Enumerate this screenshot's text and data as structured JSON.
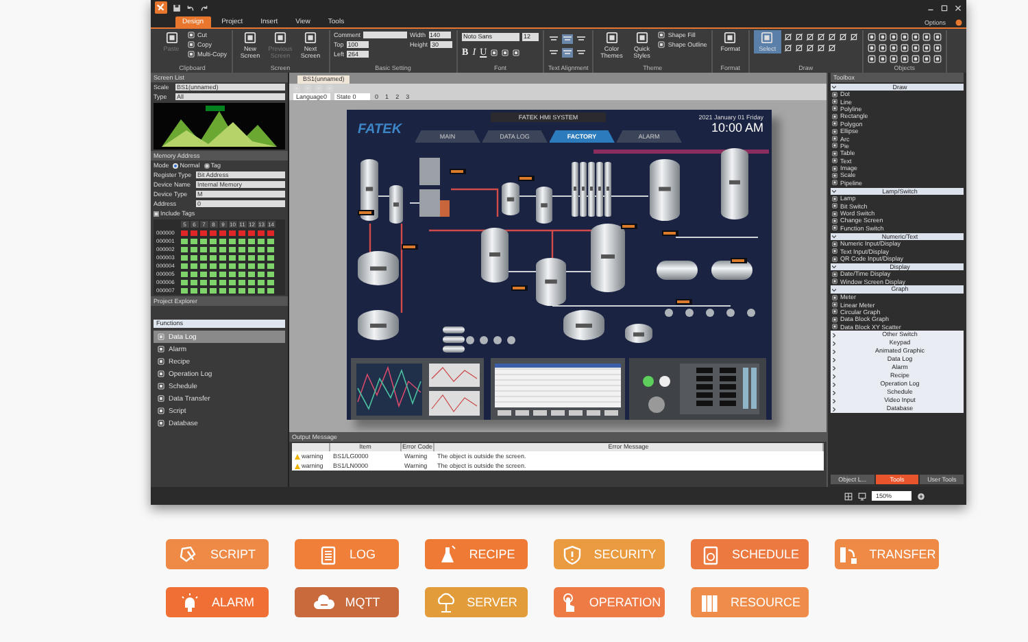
{
  "window": {
    "menu_tabs": [
      {
        "label": "Design",
        "selected": true
      },
      {
        "label": "Project",
        "selected": false
      },
      {
        "label": "Insert",
        "selected": false
      },
      {
        "label": "View",
        "selected": false
      },
      {
        "label": "Tools",
        "selected": false
      }
    ],
    "options_label": "Options",
    "ribbon": [
      {
        "name": "Clipboard",
        "kind": "buttons",
        "items": [
          {
            "kind": "large",
            "label": "Paste",
            "disabled": true
          },
          {
            "kind": "small",
            "label": "Cut"
          },
          {
            "kind": "small",
            "label": "Copy"
          },
          {
            "kind": "small",
            "label": "Multi-Copy"
          }
        ]
      },
      {
        "name": "Screen",
        "kind": "buttons",
        "items": [
          {
            "kind": "large",
            "label": "New Screen",
            "disabled": false
          },
          {
            "kind": "large",
            "label": "Previous Screen",
            "disabled": true
          },
          {
            "kind": "large",
            "label": "Next Screen",
            "disabled": false
          }
        ]
      },
      {
        "name": "Basic Setting",
        "kind": "buttons",
        "items": [
          {
            "kind": "field",
            "label": "Comment"
          },
          {
            "kind": "field",
            "label": "Top",
            "value": "100"
          },
          {
            "kind": "field",
            "label": "Left",
            "value": "264"
          },
          {
            "kind": "field",
            "label": "Width",
            "value": "140"
          },
          {
            "kind": "field",
            "label": "Height",
            "value": "30"
          }
        ]
      },
      {
        "name": "Font",
        "kind": "font",
        "font": "Noto Sans",
        "size": "12",
        "styles": [
          "B",
          "I",
          "U"
        ]
      },
      {
        "name": "Text Alignment",
        "kind": "align",
        "buttons": [
          {
            "selected": false
          },
          {
            "selected": true
          },
          {
            "selected": false
          },
          {
            "selected": false
          },
          {
            "selected": true
          },
          {
            "selected": false
          }
        ]
      },
      {
        "name": "Theme",
        "kind": "buttons",
        "items": [
          {
            "kind": "large",
            "label": "Color Themes",
            "disabled": false
          },
          {
            "kind": "large",
            "label": "Quick Styles",
            "disabled": false
          },
          {
            "kind": "small",
            "label": "Shape Fill"
          },
          {
            "kind": "small",
            "label": "Shape Outline"
          }
        ]
      },
      {
        "name": "Format",
        "kind": "buttons",
        "items": [
          {
            "kind": "large",
            "label": "Format",
            "disabled": false
          }
        ]
      },
      {
        "name": "Draw",
        "kind": "draw",
        "items": [
          {
            "kind": "large",
            "label": "Select",
            "disabled": false,
            "selected": true
          }
        ]
      },
      {
        "name": "Objects",
        "kind": "objects"
      }
    ],
    "screen_list": {
      "title": "Screen List",
      "scale_label": "Scale",
      "screen": "BS1(unnamed)",
      "type_label": "Type",
      "type": "All"
    },
    "memory_address": {
      "title": "Memory Address",
      "mode_label": "Mode",
      "modes": [
        {
          "label": "Normal",
          "selected": true
        },
        {
          "label": "Tag",
          "selected": false
        }
      ],
      "fields": [
        {
          "label": "Register Type",
          "value": "Bit Address"
        },
        {
          "label": "Device Name",
          "value": "Internal Memory"
        },
        {
          "label": "Device Type",
          "value": "M"
        },
        {
          "label": "Address",
          "value": "0"
        }
      ],
      "include_tags": {
        "label": "Include Tags",
        "checked": false
      },
      "columns": [
        "5",
        "6",
        "7",
        "8",
        "9",
        "10",
        "11",
        "12",
        "13",
        "14"
      ],
      "rows": [
        {
          "label": "000000",
          "on": false
        },
        {
          "label": "000001",
          "on": true
        },
        {
          "label": "000002",
          "on": true
        },
        {
          "label": "000003",
          "on": true
        },
        {
          "label": "000004",
          "on": true
        },
        {
          "label": "000005",
          "on": true
        },
        {
          "label": "000006",
          "on": true
        },
        {
          "label": "000007",
          "on": true
        }
      ]
    },
    "project_explorer": {
      "title": "Project Explorer",
      "category": "Functions",
      "items": [
        {
          "label": "Data Log",
          "selected": true
        },
        {
          "label": "Alarm",
          "selected": false
        },
        {
          "label": "Recipe",
          "selected": false
        },
        {
          "label": "Operation Log",
          "selected": false
        },
        {
          "label": "Schedule",
          "selected": false
        },
        {
          "label": "Data Transfer",
          "selected": false
        },
        {
          "label": "Script",
          "selected": false
        },
        {
          "label": "Database",
          "selected": false
        }
      ]
    },
    "document_tab": "BS1(unnamed)",
    "language": "Language0",
    "state": "State 0",
    "state_numbers": [
      "0",
      "1",
      "2",
      "3"
    ],
    "hmi": {
      "logo": "FATEK",
      "title": "FATEK HMI SYSTEM",
      "date": "2021 January 01 Friday",
      "time": "10:00 AM",
      "tabs": [
        {
          "label": "MAIN",
          "selected": false
        },
        {
          "label": "DATA LOG",
          "selected": false
        },
        {
          "label": "FACTORY",
          "selected": true
        },
        {
          "label": "ALARM",
          "selected": false
        }
      ]
    },
    "toolbox": {
      "title": "Toolbox",
      "sections": [
        {
          "title": "Draw",
          "expanded": true,
          "items": [
            "Dot",
            "Line",
            "Polyline",
            "Rectangle",
            "Polygon",
            "Ellipse",
            "Arc",
            "Pie",
            "Table",
            "Text",
            "Image",
            "Scale",
            "Pipeline"
          ]
        },
        {
          "title": "Lamp/Switch",
          "expanded": true,
          "items": [
            "Lamp",
            "Bit Switch",
            "Word Switch",
            "Change Screen",
            "Function Switch"
          ]
        },
        {
          "title": "Numeric/Text",
          "expanded": true,
          "items": [
            "Numeric Input/Display",
            "Text Input/Display",
            "QR Code Input/Display"
          ]
        },
        {
          "title": "Display",
          "expanded": true,
          "items": [
            "Date/Time Display",
            "Window Screen Display"
          ]
        },
        {
          "title": "Graph",
          "expanded": true,
          "items": [
            "Meter",
            "Linear Meter",
            "Circular Graph",
            "Data Block Graph",
            "Data Block XY Scatter"
          ]
        },
        {
          "title": "Other Switch",
          "expanded": false
        },
        {
          "title": "Keypad",
          "expanded": false
        },
        {
          "title": "Animated Graphic",
          "expanded": false
        },
        {
          "title": "Data Log",
          "expanded": false
        },
        {
          "title": "Alarm",
          "expanded": false
        },
        {
          "title": "Recipe",
          "expanded": false
        },
        {
          "title": "Operation Log",
          "expanded": false
        },
        {
          "title": "Schedule",
          "expanded": false
        },
        {
          "title": "Video Input",
          "expanded": false
        },
        {
          "title": "Database",
          "expanded": false
        }
      ],
      "tabs": [
        {
          "label": "Object L...",
          "selected": false
        },
        {
          "label": "Tools",
          "selected": true
        },
        {
          "label": "User Tools",
          "selected": false
        }
      ]
    },
    "output": {
      "title": "Output Message",
      "columns": [
        "Item",
        "Error Code",
        "Error Message"
      ],
      "rows": [
        {
          "level": "warning",
          "item": "BS1/LG0000",
          "code": "Warning",
          "message": "The object is outside the screen."
        },
        {
          "level": "warning",
          "item": "BS1/LN0000",
          "code": "Warning",
          "message": "The object is outside the screen."
        }
      ]
    },
    "zoom": "150%"
  },
  "features": [
    {
      "label": "SCRIPT",
      "color": "#ee8a45"
    },
    {
      "label": "LOG",
      "color": "#f07f3a"
    },
    {
      "label": "RECIPE",
      "color": "#ef7a35"
    },
    {
      "label": "SECURITY",
      "color": "#eb9b3f"
    },
    {
      "label": "SCHEDULE",
      "color": "#ec7a40"
    },
    {
      "label": "TRANSFER",
      "color": "#ee8a45"
    },
    {
      "label": "ALARM",
      "color": "#ef6f35"
    },
    {
      "label": "MQTT",
      "color": "#c86a3c"
    },
    {
      "label": "SERVER",
      "color": "#e39c3a"
    },
    {
      "label": "OPERATION",
      "color": "#ee7a45"
    },
    {
      "label": "RESOURCE",
      "color": "#ef8c4a"
    }
  ]
}
